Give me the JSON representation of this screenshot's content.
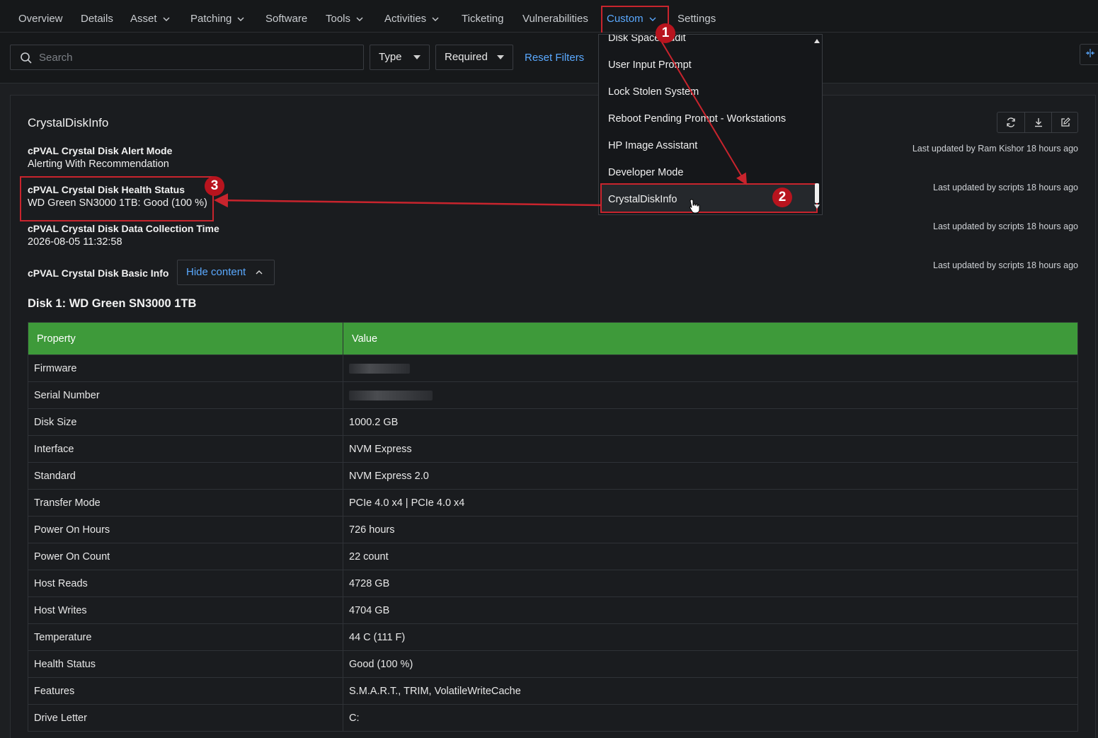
{
  "nav": {
    "items": [
      {
        "label": "Overview",
        "has_dropdown": false
      },
      {
        "label": "Details",
        "has_dropdown": false
      },
      {
        "label": "Asset",
        "has_dropdown": true
      },
      {
        "label": "Patching",
        "has_dropdown": true
      },
      {
        "label": "Software",
        "has_dropdown": false
      },
      {
        "label": "Tools",
        "has_dropdown": true
      },
      {
        "label": "Activities",
        "has_dropdown": true
      },
      {
        "label": "Ticketing",
        "has_dropdown": false
      },
      {
        "label": "Vulnerabilities",
        "has_dropdown": false
      },
      {
        "label": "Custom",
        "has_dropdown": true,
        "active": true
      },
      {
        "label": "Settings",
        "has_dropdown": false
      }
    ]
  },
  "filters": {
    "search_placeholder": "Search",
    "type_label": "Type",
    "required_label": "Required",
    "reset_label": "Reset Filters"
  },
  "custom_menu": {
    "items": [
      "Disk Space Audit",
      "User Input Prompt",
      "Lock Stolen System",
      "Reboot Pending Prompt - Workstations",
      "HP Image Assistant",
      "Developer Mode",
      "CrystalDiskInfo"
    ],
    "selected": "CrystalDiskInfo"
  },
  "section": {
    "title": "CrystalDiskInfo",
    "fields": [
      {
        "label": "cPVAL Crystal Disk Alert Mode",
        "value": "Alerting With Recommendation",
        "updated": "Last updated by Ram Kishor 18 hours ago"
      },
      {
        "label": "cPVAL Crystal Disk Health Status",
        "value": "WD Green SN3000 1TB: Good (100 %)",
        "updated": "Last updated by scripts 18 hours ago"
      },
      {
        "label": "cPVAL Crystal Disk Data Collection Time",
        "value": "2026-08-05 11:32:58",
        "updated": "Last updated by scripts 18 hours ago"
      },
      {
        "label": "cPVAL Crystal Disk Basic Info",
        "value": "",
        "updated": "Last updated by scripts 18 hours ago"
      }
    ],
    "hide_content_label": "Hide content",
    "disk_title": "Disk 1: WD Green SN3000 1TB"
  },
  "table": {
    "header_color": "#3e9a3a",
    "columns": [
      "Property",
      "Value"
    ],
    "rows": [
      {
        "property": "Firmware",
        "value": "",
        "redacted": true
      },
      {
        "property": "Serial Number",
        "value": "",
        "redacted": true
      },
      {
        "property": "Disk Size",
        "value": "1000.2 GB"
      },
      {
        "property": "Interface",
        "value": "NVM Express"
      },
      {
        "property": "Standard",
        "value": "NVM Express 2.0"
      },
      {
        "property": "Transfer Mode",
        "value": "PCIe 4.0 x4 | PCIe 4.0 x4"
      },
      {
        "property": "Power On Hours",
        "value": "726 hours"
      },
      {
        "property": "Power On Count",
        "value": "22 count"
      },
      {
        "property": "Host Reads",
        "value": "4728 GB"
      },
      {
        "property": "Host Writes",
        "value": "4704 GB"
      },
      {
        "property": "Temperature",
        "value": "44 C (111 F)"
      },
      {
        "property": "Health Status",
        "value": "Good (100 %)"
      },
      {
        "property": "Features",
        "value": "S.M.A.R.T., TRIM, VolatileWriteCache"
      },
      {
        "property": "Drive Letter",
        "value": "C:"
      }
    ]
  },
  "annotations": {
    "badges": [
      "1",
      "2",
      "3"
    ],
    "color": "#c8242d"
  }
}
